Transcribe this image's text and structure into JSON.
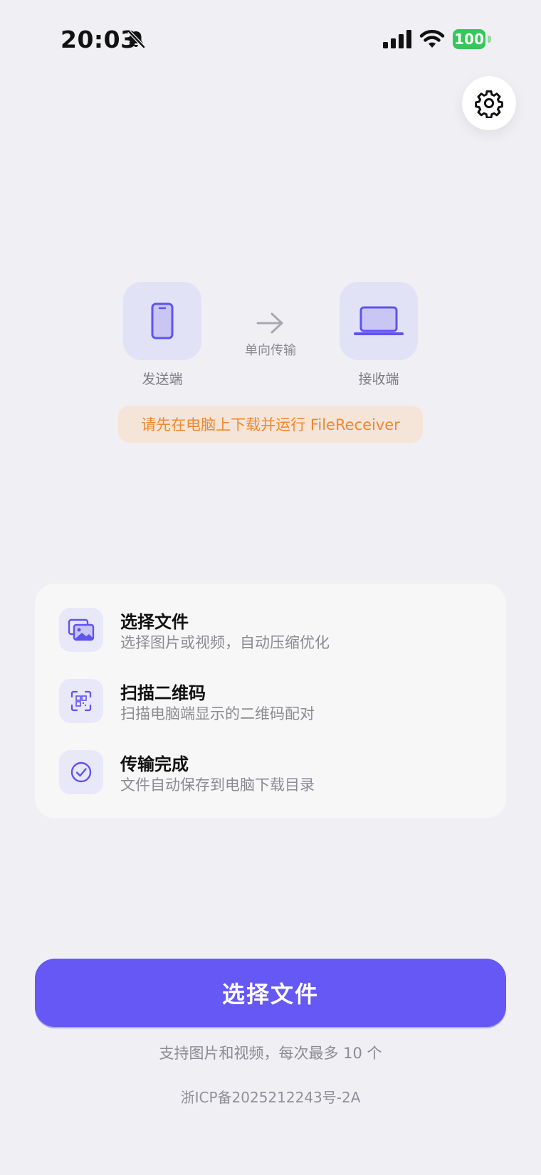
{
  "status_bar": {
    "time": "20:03",
    "battery": "100",
    "icons": [
      "bell-slash-icon",
      "cellular-signal-icon",
      "wifi-icon",
      "battery-icon"
    ]
  },
  "settings": {
    "icon": "gear-icon"
  },
  "diagram": {
    "sender_label": "发送端",
    "receiver_label": "接收端",
    "mode_label": "单向传输",
    "sender_icon": "smartphone-icon",
    "receiver_icon": "laptop-icon"
  },
  "notice": "请先在电脑上下载并运行 FileReceiver",
  "steps": [
    {
      "title": "选择文件",
      "desc": "选择图片或视频，自动压缩优化",
      "icon": "images-icon"
    },
    {
      "title": "扫描二维码",
      "desc": "扫描电脑端显示的二维码配对",
      "icon": "qr-scan-icon"
    },
    {
      "title": "传输完成",
      "desc": "文件自动保存到电脑下载目录",
      "icon": "check-circle-icon"
    }
  ],
  "main_button": "选择文件",
  "hint": "支持图片和视频，每次最多 10 个",
  "icp": "浙ICP备2025212243号-2A",
  "colors": {
    "accent": "#6558f5",
    "notice_text": "#f0882c",
    "notice_bg": "#f5e4d8",
    "battery": "#34c759",
    "background": "#efeff4"
  }
}
